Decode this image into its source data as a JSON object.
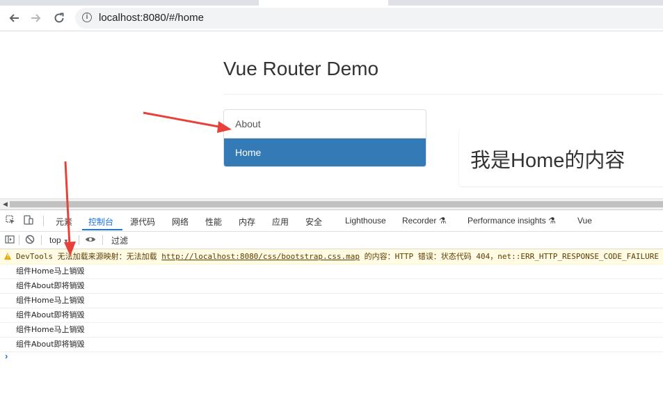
{
  "browser": {
    "url": "localhost:8080/#/home",
    "back_icon": "arrow-left-icon",
    "forward_icon": "arrow-right-icon",
    "reload_icon": "reload-icon",
    "info_icon": "info-icon"
  },
  "page": {
    "title": "Vue Router Demo",
    "nav": [
      {
        "label": "About",
        "active": false
      },
      {
        "label": "Home",
        "active": true
      }
    ],
    "content": "我是Home的内容"
  },
  "devtools": {
    "tabs": [
      "元素",
      "控制台",
      "源代码",
      "网络",
      "性能",
      "内存",
      "应用",
      "安全",
      "Lighthouse",
      "Recorder",
      "Performance insights",
      "Vue"
    ],
    "selected_tab": "控制台",
    "context": "top",
    "filter_placeholder": "过滤",
    "warning": {
      "prefix": "DevTools 无法加载来源映射：无法加载 ",
      "link": "http://localhost:8080/css/bootstrap.css.map",
      "suffix": " 的内容：HTTP 错误：状态代码 404，net::ERR_HTTP_RESPONSE_CODE_FAILURE"
    },
    "logs": [
      "组件Home马上销毁",
      "组件About即将销毁",
      "组件Home马上销毁",
      "组件About即将销毁",
      "组件Home马上销毁",
      "组件About即将销毁"
    ],
    "prompt": "›"
  },
  "colors": {
    "active_nav": "#337ab7",
    "annotation_arrow": "#e8413c",
    "selected_tab": "#1a73e8"
  }
}
